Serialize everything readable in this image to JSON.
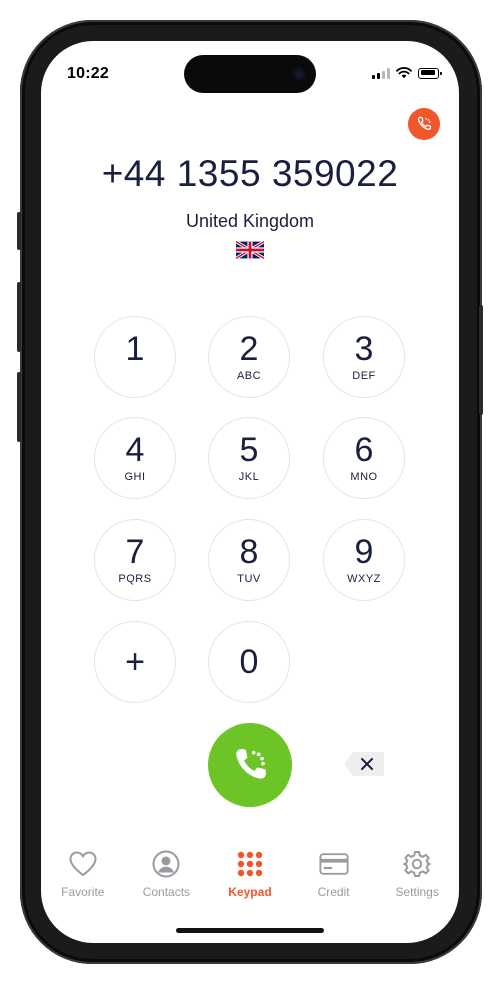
{
  "status_bar": {
    "time": "10:22"
  },
  "dialer": {
    "number": "+44 1355 359022",
    "country": "United Kingdom",
    "keys": [
      {
        "digit": "1",
        "letters": ""
      },
      {
        "digit": "2",
        "letters": "ABC"
      },
      {
        "digit": "3",
        "letters": "DEF"
      },
      {
        "digit": "4",
        "letters": "GHI"
      },
      {
        "digit": "5",
        "letters": "JKL"
      },
      {
        "digit": "6",
        "letters": "MNO"
      },
      {
        "digit": "7",
        "letters": "PQRS"
      },
      {
        "digit": "8",
        "letters": "TUV"
      },
      {
        "digit": "9",
        "letters": "WXYZ"
      },
      {
        "digit": "+",
        "letters": ""
      },
      {
        "digit": "0",
        "letters": ""
      }
    ]
  },
  "tabs": [
    {
      "label": "Favorite",
      "icon": "heart-icon",
      "active": false
    },
    {
      "label": "Contacts",
      "icon": "person-icon",
      "active": false
    },
    {
      "label": "Keypad",
      "icon": "keypad-icon",
      "active": true
    },
    {
      "label": "Credit",
      "icon": "card-icon",
      "active": false
    },
    {
      "label": "Settings",
      "icon": "gear-icon",
      "active": false
    }
  ],
  "colors": {
    "accent": "#f0562a",
    "call": "#6cc427",
    "text": "#1a1f3d",
    "inactive": "#9a9aa0"
  }
}
